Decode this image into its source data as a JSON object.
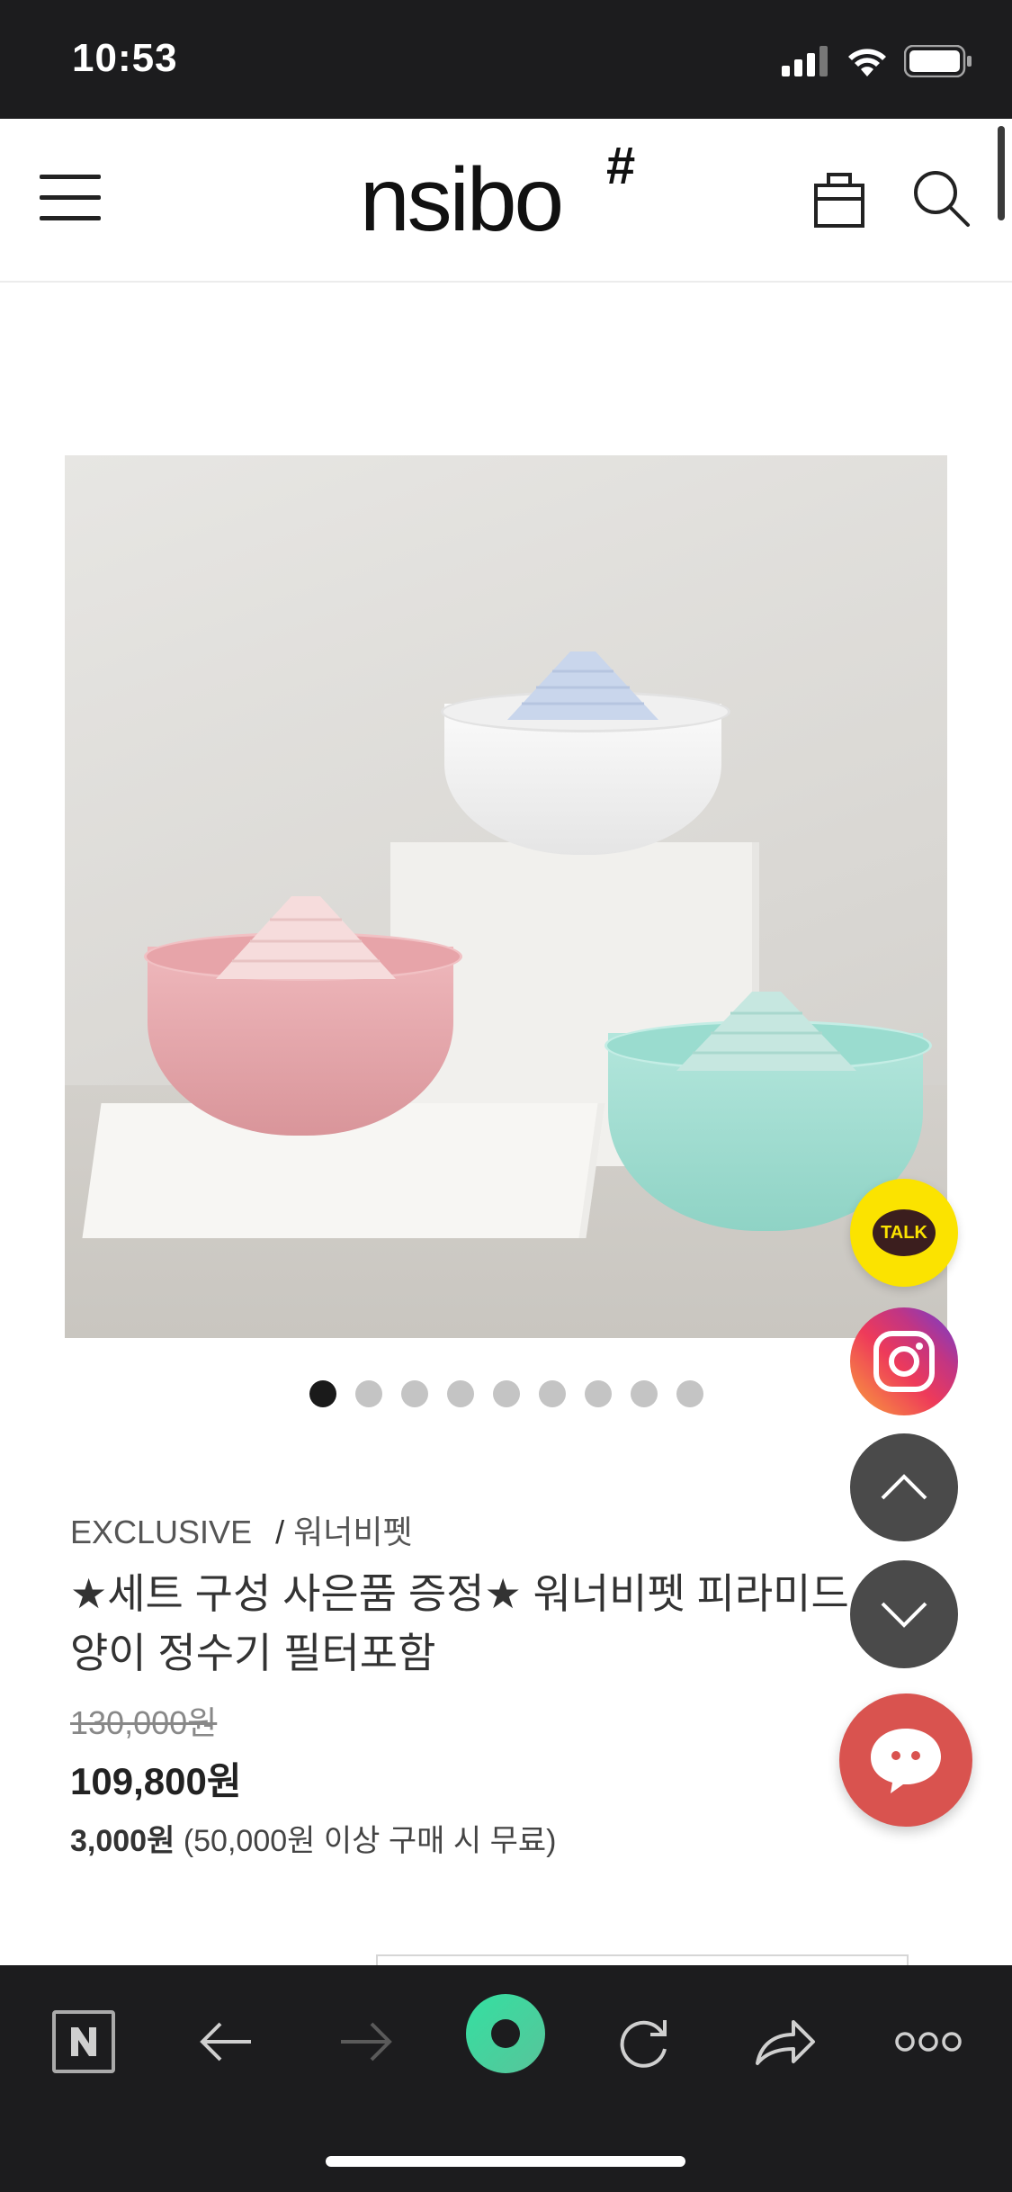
{
  "status_bar": {
    "time": "10:53"
  },
  "header": {
    "logo": "nsibo",
    "logo_mark": "#"
  },
  "product": {
    "category": "EXCLUSIVE",
    "category_sep": "/",
    "brand": "워너비펫",
    "title": "★세트 구성 사은품 증정★ 워너비펫 피라미드 양이 정수기 필터포함",
    "original_price": "130,000원",
    "sale_price": "109,800원",
    "shipping_fee": "3,000원",
    "shipping_note": "(50,000원 이상 구매 시 무료)",
    "image_count": 9,
    "active_image": 1
  },
  "floating": {
    "talk_label": "TALK"
  },
  "colors": {
    "kakao_yellow": "#fbe300",
    "chat_red": "#d9534f",
    "pink_bowl": "#e9a9ae",
    "white_bowl": "#f4f4f4",
    "mint_bowl": "#9fdcd0",
    "toolbar_accent": "#43d39e"
  }
}
